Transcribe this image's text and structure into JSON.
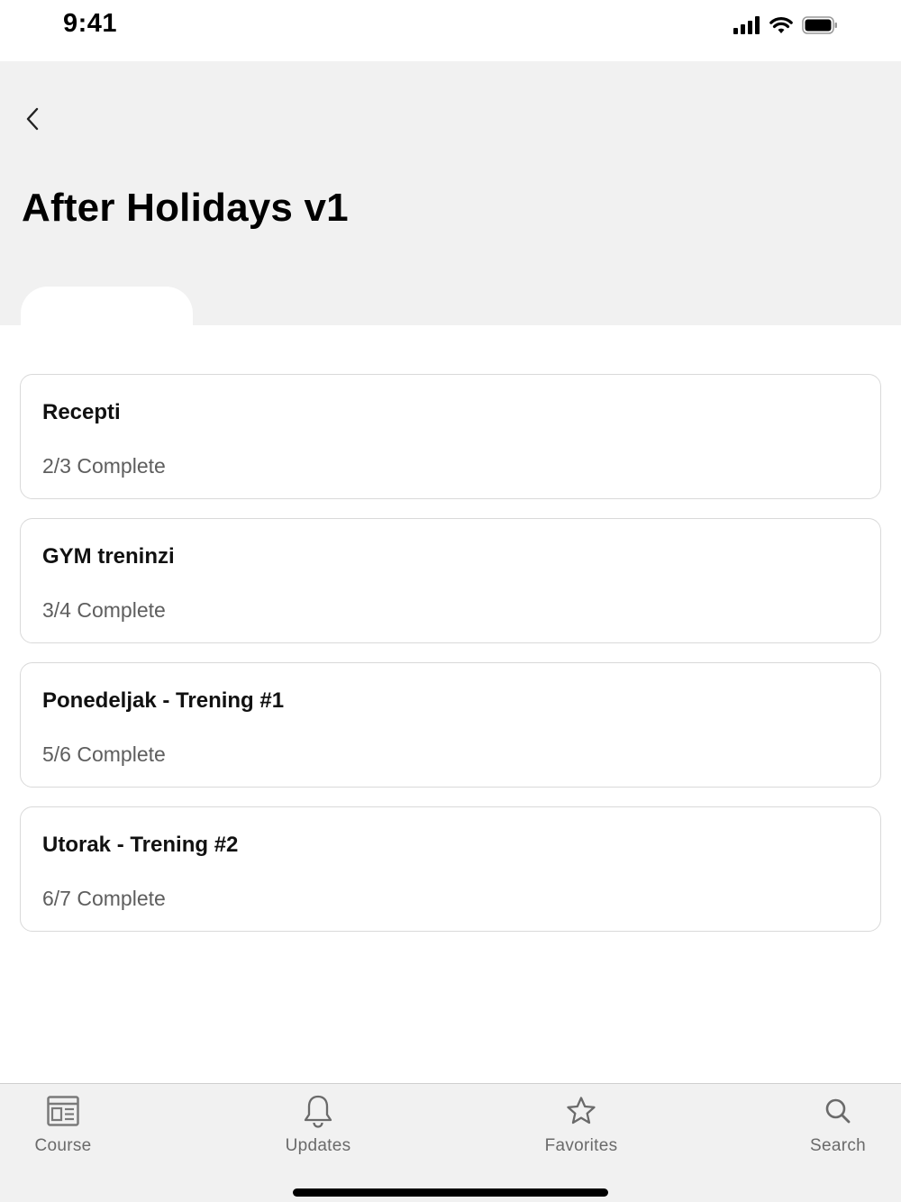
{
  "status_bar": {
    "time": "9:41"
  },
  "header": {
    "title": "After Holidays v1"
  },
  "modules": [
    {
      "title": "Recepti",
      "progress": "2/3 Complete"
    },
    {
      "title": "GYM treninzi",
      "progress": "3/4 Complete"
    },
    {
      "title": "Ponedeljak - Trening #1",
      "progress": "5/6 Complete"
    },
    {
      "title": "Utorak - Trening #2",
      "progress": "6/7 Complete"
    }
  ],
  "tab_bar": {
    "tabs": [
      {
        "label": "Course",
        "icon": "course-icon"
      },
      {
        "label": "Updates",
        "icon": "bell-icon"
      },
      {
        "label": "Favorites",
        "icon": "star-icon"
      },
      {
        "label": "Search",
        "icon": "search-icon"
      }
    ]
  },
  "colors": {
    "header_bg": "#f1f1f1",
    "card_border": "#d9d9d9",
    "secondary_text": "#5e5e5e",
    "tab_label": "#6a6a6a"
  }
}
